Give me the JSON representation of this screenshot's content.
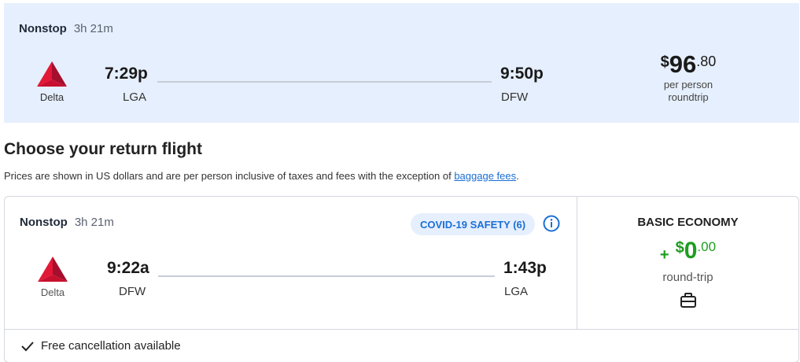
{
  "outbound": {
    "stops": "Nonstop",
    "duration": "3h 21m",
    "airline": {
      "name": "Delta",
      "logo_icon": "delta-logo-icon"
    },
    "departure": {
      "time": "7:29p",
      "airport": "LGA"
    },
    "arrival": {
      "time": "9:50p",
      "airport": "DFW"
    },
    "price": {
      "currency": "$",
      "whole": "96",
      "cents": ".80",
      "per": "per person",
      "trip": "roundtrip"
    }
  },
  "section": {
    "heading": "Choose your return flight",
    "disclaimer_text": "Prices are shown in US dollars and are per person inclusive of taxes and fees with the exception of ",
    "disclaimer_link": "baggage fees",
    "disclaimer_end": "."
  },
  "return_flight": {
    "stops": "Nonstop",
    "duration": "3h 21m",
    "covid_badge": "COVID-19 SAFETY (6)",
    "airline": {
      "name": "Delta",
      "logo_icon": "delta-logo-icon"
    },
    "departure": {
      "time": "9:22a",
      "airport": "DFW"
    },
    "arrival": {
      "time": "1:43p",
      "airport": "LGA"
    },
    "fare": {
      "title": "BASIC ECONOMY",
      "plus": "+",
      "currency": "$",
      "whole": "0",
      "cents": ".00",
      "sub": "round-trip",
      "bag_icon": "carry-on-bag-icon"
    },
    "cancellation": "Free cancellation available"
  },
  "colors": {
    "accent_blue": "#1a6fd6",
    "card_bg": "#e6effd",
    "price_green": "#1f9d1f",
    "delta_red": "#c8102e"
  }
}
